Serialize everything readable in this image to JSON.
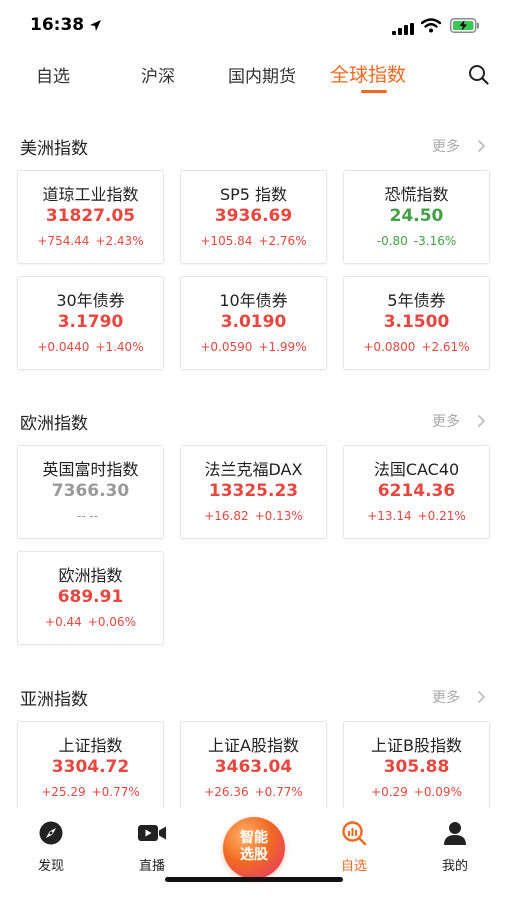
{
  "status": {
    "time": "16:38"
  },
  "tabs": [
    {
      "label": "自选"
    },
    {
      "label": "沪深"
    },
    {
      "label": "国内期货"
    },
    {
      "label": "全球指数"
    }
  ],
  "sections": [
    {
      "title": "美洲指数",
      "more": "更多",
      "cards": [
        {
          "name": "道琼工业指数",
          "value": "31827.05",
          "change": "+754.44",
          "pct": "+2.43%",
          "trend": "up"
        },
        {
          "name": "SP5 指数",
          "value": "3936.69",
          "change": "+105.84",
          "pct": "+2.76%",
          "trend": "up"
        },
        {
          "name": "恐慌指数",
          "value": "24.50",
          "change": "-0.80",
          "pct": "-3.16%",
          "trend": "down"
        },
        {
          "name": "30年债券",
          "value": "3.1790",
          "change": "+0.0440",
          "pct": "+1.40%",
          "trend": "up"
        },
        {
          "name": "10年债券",
          "value": "3.0190",
          "change": "+0.0590",
          "pct": "+1.99%",
          "trend": "up"
        },
        {
          "name": "5年债券",
          "value": "3.1500",
          "change": "+0.0800",
          "pct": "+2.61%",
          "trend": "up"
        }
      ]
    },
    {
      "title": "欧洲指数",
      "more": "更多",
      "cards": [
        {
          "name": "英国富时指数",
          "value": "7366.30",
          "change": "-- --",
          "pct": "",
          "trend": "flat"
        },
        {
          "name": "法兰克福DAX",
          "value": "13325.23",
          "change": "+16.82",
          "pct": "+0.13%",
          "trend": "up"
        },
        {
          "name": "法国CAC40",
          "value": "6214.36",
          "change": "+13.14",
          "pct": "+0.21%",
          "trend": "up"
        },
        {
          "name": "欧洲指数",
          "value": "689.91",
          "change": "+0.44",
          "pct": "+0.06%",
          "trend": "up"
        }
      ]
    },
    {
      "title": "亚洲指数",
      "more": "更多",
      "cards": [
        {
          "name": "上证指数",
          "value": "3304.72",
          "change": "+25.29",
          "pct": "+0.77%",
          "trend": "up"
        },
        {
          "name": "上证A股指数",
          "value": "3463.04",
          "change": "+26.36",
          "pct": "+0.77%",
          "trend": "up"
        },
        {
          "name": "上证B股指数",
          "value": "305.88",
          "change": "+0.29",
          "pct": "+0.09%",
          "trend": "up"
        }
      ]
    }
  ],
  "bottom_nav": {
    "discover": "发现",
    "live": "直播",
    "center": "智能\n选股",
    "watchlist": "自选",
    "mine": "我的"
  },
  "colors": {
    "accent": "#f26a22",
    "up": "#e8473f",
    "down": "#43a047",
    "flat": "#999999"
  }
}
